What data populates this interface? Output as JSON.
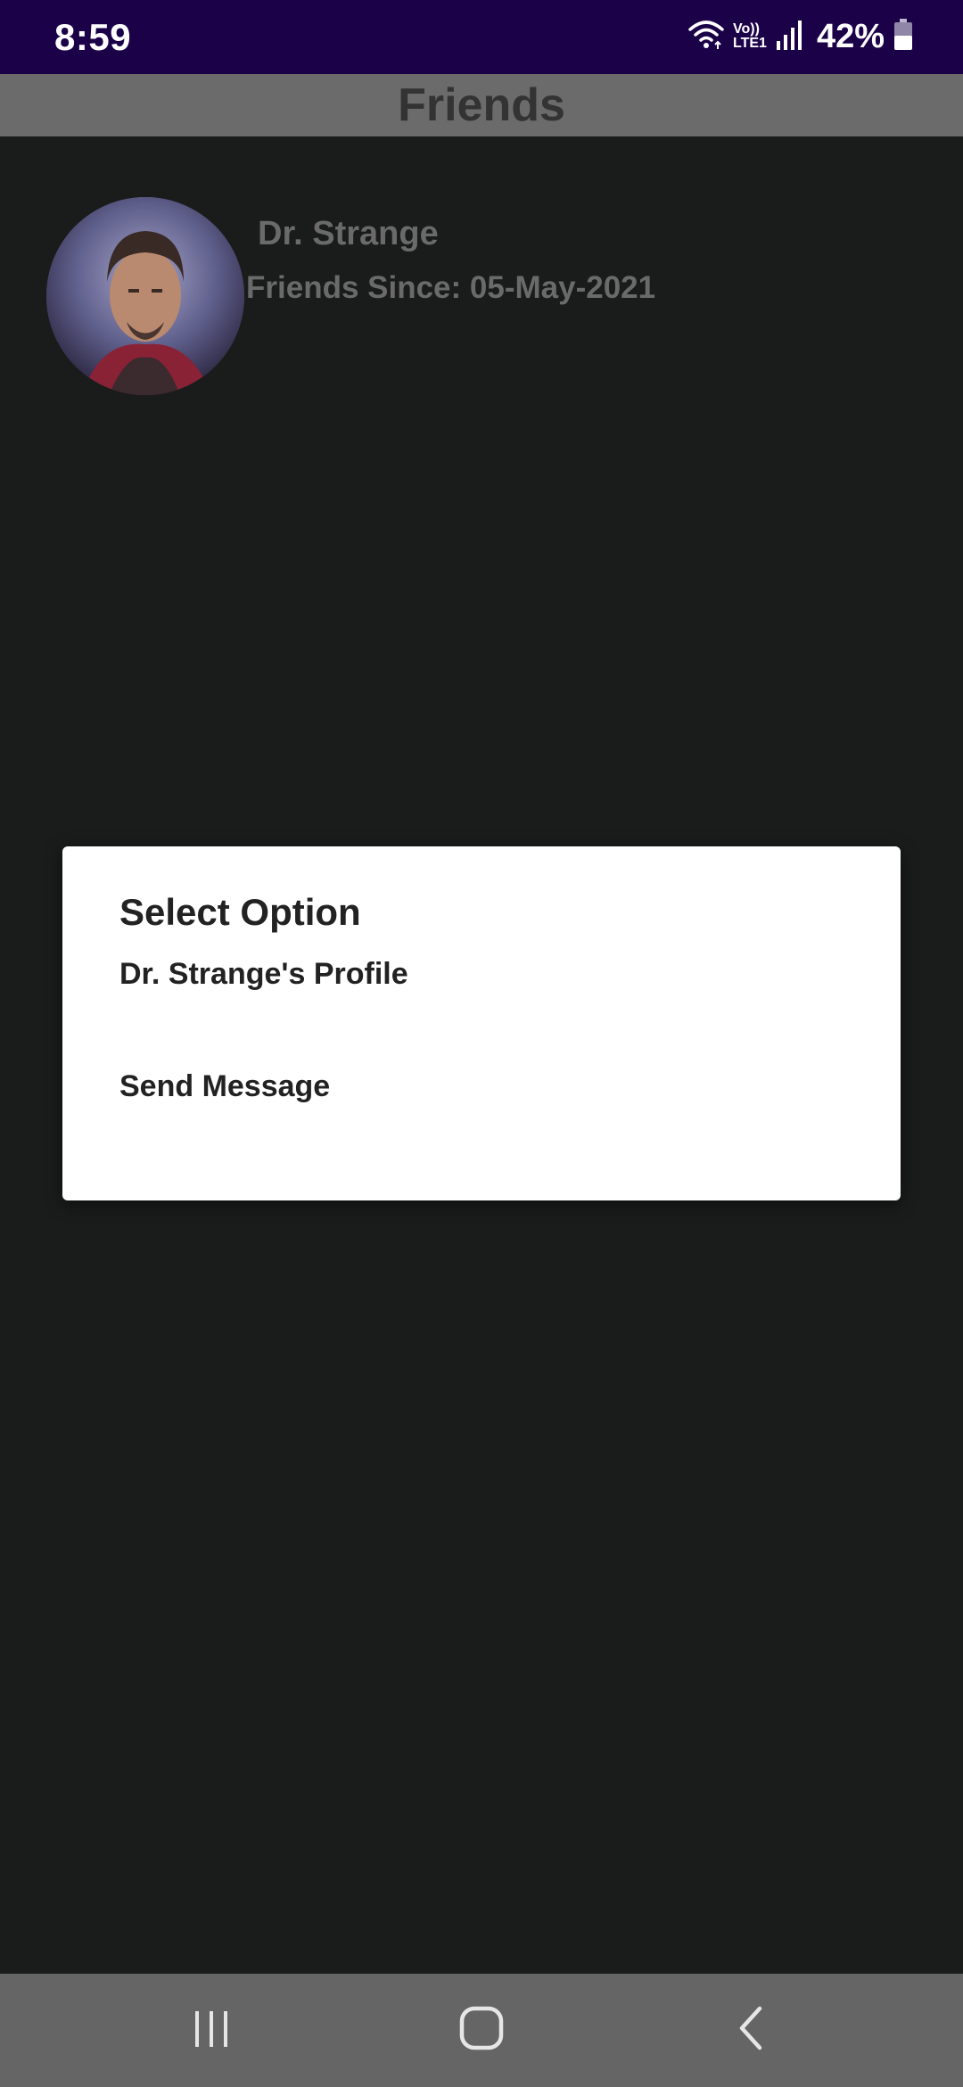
{
  "status_bar": {
    "time": "8:59",
    "volte_top": "Vo))",
    "volte_bottom": "LTE1",
    "battery_percent": "42%",
    "icons": [
      "wifi-icon",
      "signal-icon",
      "battery-icon"
    ]
  },
  "app_bar": {
    "title": "Friends"
  },
  "friends": [
    {
      "name": "Dr. Strange",
      "since": "Friends Since: 05-May-2021",
      "avatar": "avatar-photo"
    }
  ],
  "dialog": {
    "title": "Select Option",
    "options": [
      {
        "label": "Dr. Strange's Profile"
      },
      {
        "label": "Send Message"
      }
    ]
  },
  "nav_bar": {
    "buttons": [
      "recent-apps-icon",
      "home-icon",
      "back-icon"
    ]
  },
  "colors": {
    "status_bar": "#1b0148",
    "app_bar_dimmed": "#6b6b6b",
    "background_dimmed": "#1a1b1b",
    "dialog": "#ffffff",
    "nav_bar": "#656565"
  }
}
